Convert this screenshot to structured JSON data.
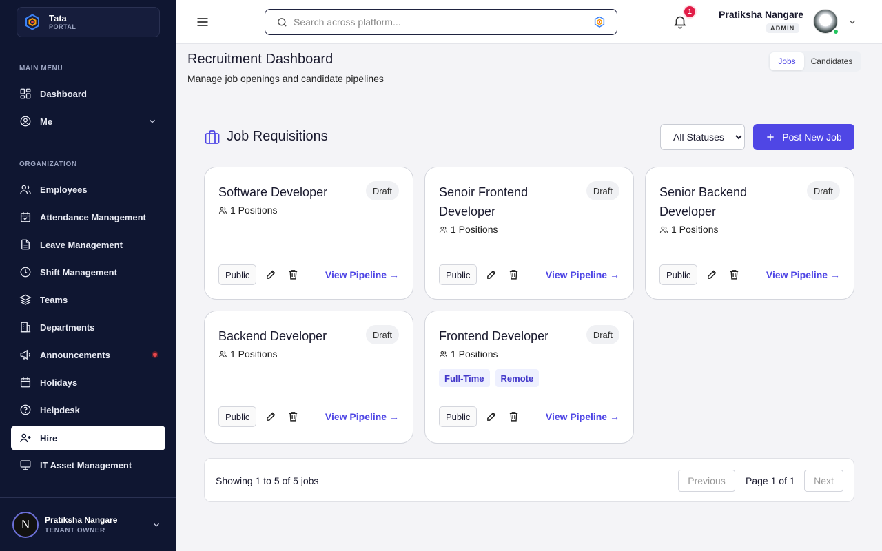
{
  "brand": {
    "name": "Tata",
    "sub": "PORTAL"
  },
  "sidebar": {
    "main_menu_label": "MAIN MENU",
    "org_label": "ORGANIZATION",
    "main_items": [
      {
        "label": "Dashboard",
        "icon": "dashboard-icon"
      },
      {
        "label": "Me",
        "icon": "user-circle-icon"
      }
    ],
    "org_items": [
      {
        "label": "Employees",
        "icon": "users-icon"
      },
      {
        "label": "Attendance Management",
        "icon": "calendar-check-icon"
      },
      {
        "label": "Leave Management",
        "icon": "document-icon"
      },
      {
        "label": "Shift Management",
        "icon": "clock-icon"
      },
      {
        "label": "Teams",
        "icon": "layers-icon"
      },
      {
        "label": "Departments",
        "icon": "building-icon"
      },
      {
        "label": "Announcements",
        "icon": "megaphone-icon"
      },
      {
        "label": "Holidays",
        "icon": "calendar-icon"
      },
      {
        "label": "Helpdesk",
        "icon": "help-circle-icon"
      },
      {
        "label": "Hire",
        "icon": "user-plus-icon",
        "active": true
      },
      {
        "label": "IT Asset Management",
        "icon": "monitor-icon"
      }
    ],
    "footer": {
      "avatar_letter": "N",
      "name": "Pratiksha Nangare",
      "role": "TENANT OWNER"
    }
  },
  "header": {
    "search_placeholder": "Search across platform...",
    "notification_count": "1",
    "user_name": "Pratiksha Nangare",
    "user_role": "ADMIN"
  },
  "main": {
    "title": "Recruitment Dashboard",
    "subtitle": "Manage job openings and candidate pipelines",
    "toggle": {
      "jobs": "Jobs",
      "candidates": "Candidates"
    },
    "section_title": "Job Requisitions",
    "status_filter": {
      "selected": "All Statuses",
      "options": [
        "All Statuses"
      ]
    },
    "post_button": "Post New Job",
    "jobs": [
      {
        "title": "Software Developer",
        "status": "Draft",
        "positions": "1 Positions",
        "tags": [],
        "visibility": "Public",
        "pipeline_label": "View Pipeline →"
      },
      {
        "title": "Senoir Frontend Developer",
        "status": "Draft",
        "positions": "1 Positions",
        "tags": [],
        "visibility": "Public",
        "pipeline_label": "View Pipeline →"
      },
      {
        "title": "Senior Backend Developer",
        "status": "Draft",
        "positions": "1 Positions",
        "tags": [],
        "visibility": "Public",
        "pipeline_label": "View Pipeline →"
      },
      {
        "title": "Backend Developer",
        "status": "Draft",
        "positions": "1 Positions",
        "tags": [],
        "visibility": "Public",
        "pipeline_label": "View Pipeline →"
      },
      {
        "title": "Frontend Developer",
        "status": "Draft",
        "positions": "1 Positions",
        "tags": [
          "Full-Time",
          "Remote"
        ],
        "visibility": "Public",
        "pipeline_label": "View Pipeline →"
      }
    ],
    "pagination": {
      "info": "Showing 1 to 5 of 5 jobs",
      "previous": "Previous",
      "page": "Page 1 of 1",
      "next": "Next"
    }
  },
  "colors": {
    "accent": "#4f46e5",
    "sidebar_bg": "#0f1631",
    "alert": "#e11d48",
    "online": "#22c55e"
  }
}
